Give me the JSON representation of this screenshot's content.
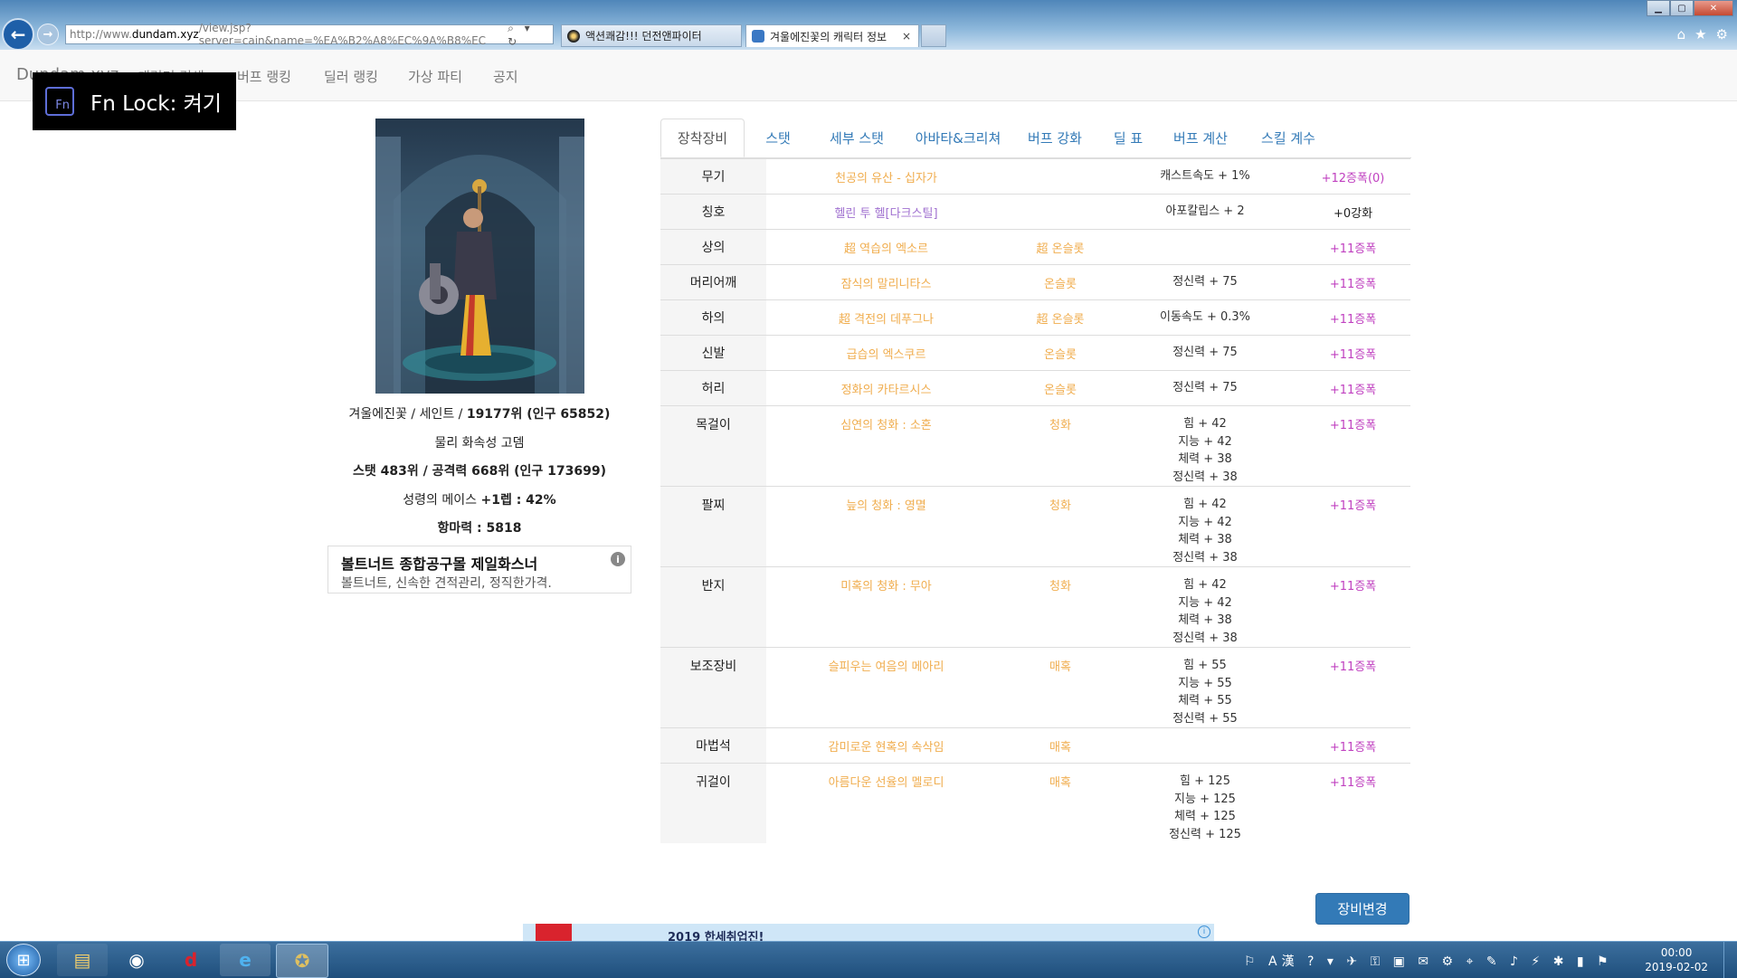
{
  "browser": {
    "address_host": "http://www.",
    "address_domain": "dundam.xyz",
    "address_path": "/view.jsp?server=cain&name=%EA%B2%A8%EC%9A%B8%EC",
    "address_tools": "⌕ ▾ ↻",
    "tabs": [
      {
        "label": "액션쾌감!!! 던전앤파이터"
      },
      {
        "label": "겨울에진꽃의 캐릭터 정보",
        "close": "×"
      }
    ],
    "win_controls": [
      "▁",
      "▢",
      "✕"
    ],
    "right_icons": [
      "⌂",
      "★",
      "⚙"
    ]
  },
  "site_nav": {
    "brand": "Dundam.xyz",
    "links": [
      "캐릭터 검색",
      "버프 랭킹",
      "딜러 랭킹",
      "가상 파티",
      "공지"
    ]
  },
  "fn_lock": {
    "icon_text": "Fn",
    "text": "Fn Lock: 켜기"
  },
  "profile": {
    "line1_text": "겨울에진꽃 / 세인트 / ",
    "line1_bold": "19177위 (인구 65852)",
    "line2": "물리 화속성 고뎀",
    "line3_text": "스탯 483위 / 공격력 668위 (인구 173699)",
    "line4_text": "성령의 메이스 ",
    "line4_bold": "+1렙 : 42%",
    "line5_text": "항마력 : 5818"
  },
  "ad": {
    "title": "볼트너트 종합공구몰 제일화스너",
    "desc": "볼트너트, 신속한 견적관리, 정직한가격.",
    "info": "i"
  },
  "tabs": [
    "장착장비",
    "스탯",
    "세부 스탯",
    "아바타&크리쳐",
    "버프 강화",
    "딜 표",
    "버프 계산",
    "스킬 계수"
  ],
  "equipment": [
    {
      "slot": "무기",
      "item": "천공의 유산 - 십자가",
      "item_color": "yellow",
      "set": "",
      "stats": [
        "캐스트속도 + 1%"
      ],
      "reinforce": "+12증폭(0)",
      "reinforce_plain": false
    },
    {
      "slot": "칭호",
      "item": "헬린 투 헬[다크스틸]",
      "item_color": "purple",
      "set": "",
      "stats": [
        "아포칼립스 + 2"
      ],
      "reinforce": "+0강화",
      "reinforce_plain": true
    },
    {
      "slot": "상의",
      "item": "超 역습의 엑소르",
      "item_color": "yellow",
      "set": "超 온슬롯",
      "stats": [],
      "reinforce": "+11증폭",
      "reinforce_plain": false
    },
    {
      "slot": "머리어깨",
      "item": "잠식의 말리니타스",
      "item_color": "yellow",
      "set": "온슬롯",
      "stats": [
        "정신력 + 75"
      ],
      "reinforce": "+11증폭",
      "reinforce_plain": false
    },
    {
      "slot": "하의",
      "item": "超 격전의 데푸그나",
      "item_color": "yellow",
      "set": "超 온슬롯",
      "stats": [
        "이동속도 + 0.3%"
      ],
      "reinforce": "+11증폭",
      "reinforce_plain": false
    },
    {
      "slot": "신발",
      "item": "급습의 엑스쿠르",
      "item_color": "yellow",
      "set": "온슬롯",
      "stats": [
        "정신력 + 75"
      ],
      "reinforce": "+11증폭",
      "reinforce_plain": false
    },
    {
      "slot": "허리",
      "item": "정화의 카타르시스",
      "item_color": "yellow",
      "set": "온슬롯",
      "stats": [
        "정신력 + 75"
      ],
      "reinforce": "+11증폭",
      "reinforce_plain": false
    },
    {
      "slot": "목걸이",
      "item": "심연의 청화 : 소혼",
      "item_color": "yellow",
      "set": "청화",
      "stats": [
        "힘 + 42",
        "지능 + 42",
        "체력 + 38",
        "정신력 + 38"
      ],
      "reinforce": "+11증폭",
      "reinforce_plain": false
    },
    {
      "slot": "팔찌",
      "item": "늪의 청화 : 영멸",
      "item_color": "yellow",
      "set": "청화",
      "stats": [
        "힘 + 42",
        "지능 + 42",
        "체력 + 38",
        "정신력 + 38"
      ],
      "reinforce": "+11증폭",
      "reinforce_plain": false
    },
    {
      "slot": "반지",
      "item": "미혹의 청화 : 무아",
      "item_color": "yellow",
      "set": "청화",
      "stats": [
        "힘 + 42",
        "지능 + 42",
        "체력 + 38",
        "정신력 + 38"
      ],
      "reinforce": "+11증폭",
      "reinforce_plain": false
    },
    {
      "slot": "보조장비",
      "item": "슬피우는 여음의 메아리",
      "item_color": "yellow",
      "set": "매혹",
      "stats": [
        "힘 + 55",
        "지능 + 55",
        "체력 + 55",
        "정신력 + 55"
      ],
      "reinforce": "+11증폭",
      "reinforce_plain": false
    },
    {
      "slot": "마법석",
      "item": "감미로운 현혹의 속삭임",
      "item_color": "yellow",
      "set": "매혹",
      "stats": [],
      "reinforce": "+11증폭",
      "reinforce_plain": false
    },
    {
      "slot": "귀걸이",
      "item": "아름다운 선율의 멜로디",
      "item_color": "yellow",
      "set": "매혹",
      "stats": [
        "힘 + 125",
        "지능 + 125",
        "체력 + 125",
        "정신력 + 125"
      ],
      "reinforce": "+11증폭",
      "reinforce_plain": false
    }
  ],
  "change_button": "장비변경",
  "banner": {
    "text": "2019 한세취업진!",
    "info": "i"
  },
  "taskbar": {
    "start": "⊞",
    "apps": [
      "▤",
      "◉",
      "d",
      "e",
      "✪"
    ],
    "tray": "⚐ A漢 ? ▾ ✈ ⚿ ▣ ✉ ⚙ ⌖ ✎ ♪ ⚡ ✱ ▮ ⚑",
    "time": "00:00",
    "date": "2019-02-02"
  },
  "colors": {
    "yellow": "#f0ad4e",
    "purple": "#a070d0",
    "reinforce": "#c040c0",
    "link": "#337ab7"
  }
}
